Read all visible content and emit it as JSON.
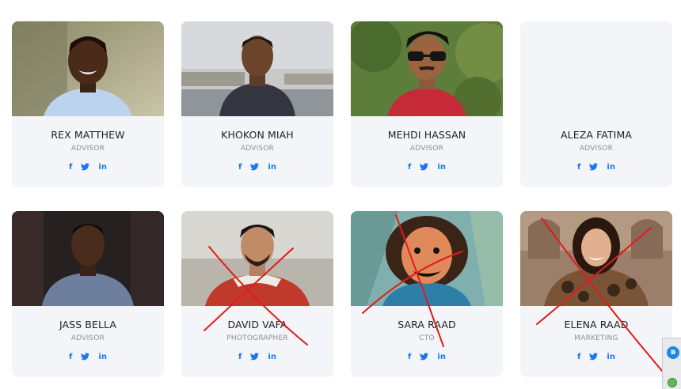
{
  "team": [
    {
      "name": "REX MATTHEW",
      "role": "ADVISOR",
      "photo": "portrait-young-man-smiling"
    },
    {
      "name": "KHOKON MIAH",
      "role": "ADVISOR",
      "photo": "portrait-man-riverside"
    },
    {
      "name": "MEHDI HASSAN",
      "role": "ADVISOR",
      "photo": "portrait-man-sunglasses"
    },
    {
      "name": "ALEZA FATIMA",
      "role": "ADVISOR",
      "photo": "empty"
    },
    {
      "name": "JASS BELLA",
      "role": "ADVISOR",
      "photo": "portrait-man-studio"
    },
    {
      "name": "DAVID VAFA",
      "role": "PHOTOGRAPHER",
      "photo": "portrait-man-red-jacket"
    },
    {
      "name": "SARA RAAD",
      "role": "CTO",
      "photo": "portrait-woman-painted"
    },
    {
      "name": "ELENA RAAD",
      "role": "MARKETING",
      "photo": "portrait-woman-fur-coat"
    }
  ],
  "social": {
    "facebook": "f",
    "twitter": "twitter-icon",
    "linkedin": "in"
  },
  "colors": {
    "card_bg": "#f4f5f9",
    "icon": "#1877f2",
    "annotation": "#e21b1b"
  },
  "tray": {
    "bluetooth": "ʙ"
  }
}
